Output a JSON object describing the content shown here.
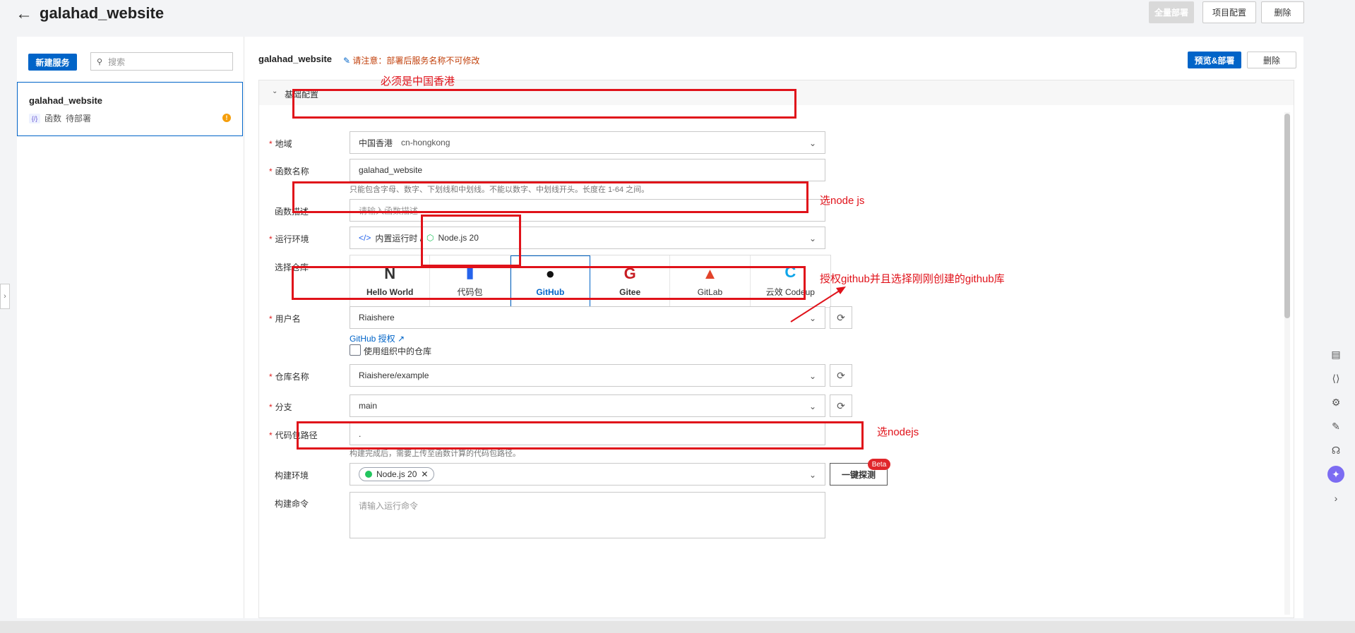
{
  "header": {
    "back_icon": "arrow-left-icon",
    "title": "galahad_website",
    "deploy_all": "全量部署",
    "project_config": "项目配置",
    "delete": "删除"
  },
  "sidebar": {
    "new_service": "新建服务",
    "search_placeholder": "搜索",
    "service": {
      "name": "galahad_website",
      "type": "函数",
      "status": "待部署",
      "status_indicator": "!"
    }
  },
  "content": {
    "service_name": "galahad_website",
    "notice": "请注意：部署后服务名称不可修改",
    "preview_deploy": "预览&部署",
    "delete": "删除",
    "section_title": "基础配置",
    "region": {
      "label": "地域",
      "value": "中国香港",
      "code": "cn-hongkong"
    },
    "function_name": {
      "label": "函数名称",
      "value": "galahad_website",
      "hint": "只能包含字母、数字、下划线和中划线。不能以数字、中划线开头。长度在 1-64 之间。"
    },
    "function_desc": {
      "label": "函数描述",
      "placeholder": "请输入函数描述"
    },
    "runtime": {
      "label": "运行环境",
      "category": "内置运行时 /",
      "value": "Node.js 20"
    },
    "repo": {
      "label": "选择仓库",
      "tiles": [
        {
          "name": "Hello World",
          "icon": "N"
        },
        {
          "name": "代码包",
          "icon": "▮"
        },
        {
          "name": "GitHub",
          "icon": "●"
        },
        {
          "name": "Gitee",
          "icon": "G"
        },
        {
          "name": "GitLab",
          "icon": "▲"
        },
        {
          "name": "云效 Codeup",
          "icon": "C"
        }
      ]
    },
    "username": {
      "label": "用户名",
      "value": "Riaishere",
      "auth_link": "GitHub 授权"
    },
    "org_checkbox": "使用组织中的仓库",
    "repo_name": {
      "label": "仓库名称",
      "value": "Riaishere/example"
    },
    "branch": {
      "label": "分支",
      "value": "main"
    },
    "code_path": {
      "label": "代码包路径",
      "value": ".",
      "hint": "构建完成后，需要上传至函数计算的代码包路径。"
    },
    "build_env": {
      "label": "构建环境",
      "tag": "Node.js 20",
      "probe": "一键探测",
      "beta": "Beta"
    },
    "build_cmd": {
      "label": "构建命令",
      "placeholder": "请输入运行命令"
    }
  },
  "annotations": {
    "region_note": "必须是中国香港",
    "runtime_note": "选node js",
    "github_note": "授权github并且选择刚刚创建的github库",
    "build_note": "选nodejs",
    "color": "#e0121a"
  },
  "colors": {
    "primary": "#0064c8",
    "warning": "#c2410c"
  }
}
